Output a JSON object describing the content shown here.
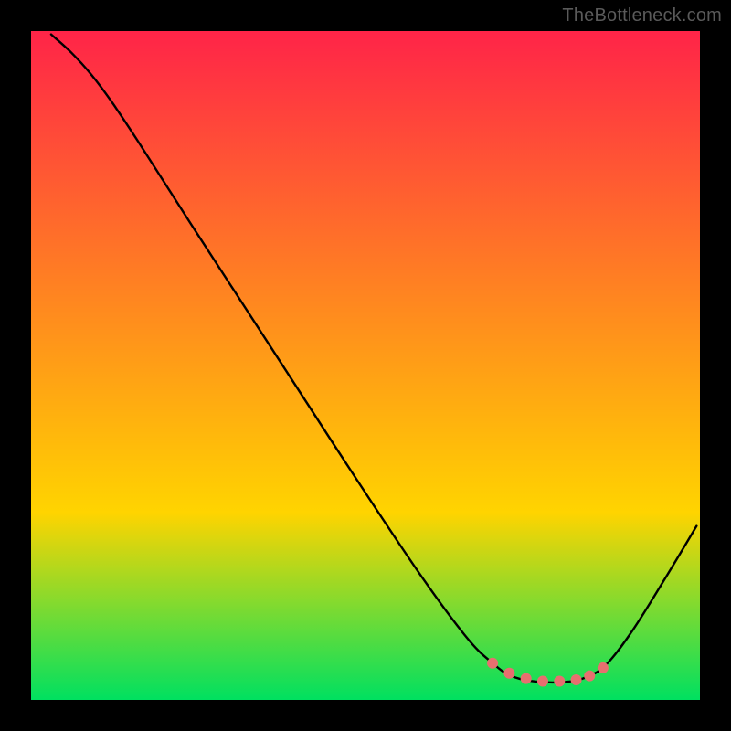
{
  "watermark": "TheBottleneck.com",
  "gradient": {
    "top": "#ff2448",
    "mid": "#ffd400",
    "bottom": "#00e060"
  },
  "curve_color": "#000000",
  "marker_color": "#e76f6f",
  "chart_data": {
    "type": "line",
    "title": "",
    "xlabel": "",
    "ylabel": "",
    "xlim": [
      0,
      100
    ],
    "ylim": [
      0,
      100
    ],
    "series": [
      {
        "name": "curve",
        "points": [
          {
            "x": 3.0,
            "y": 99.5
          },
          {
            "x": 6.0,
            "y": 96.8
          },
          {
            "x": 9.0,
            "y": 93.5
          },
          {
            "x": 12.0,
            "y": 89.5
          },
          {
            "x": 16.0,
            "y": 83.5
          },
          {
            "x": 24.0,
            "y": 71.0
          },
          {
            "x": 36.0,
            "y": 52.5
          },
          {
            "x": 48.0,
            "y": 34.0
          },
          {
            "x": 58.0,
            "y": 19.0
          },
          {
            "x": 65.0,
            "y": 9.5
          },
          {
            "x": 69.0,
            "y": 5.5
          },
          {
            "x": 72.0,
            "y": 3.5
          },
          {
            "x": 76.0,
            "y": 2.7
          },
          {
            "x": 80.0,
            "y": 2.7
          },
          {
            "x": 83.0,
            "y": 3.4
          },
          {
            "x": 86.0,
            "y": 5.3
          },
          {
            "x": 90.0,
            "y": 10.5
          },
          {
            "x": 95.0,
            "y": 18.5
          },
          {
            "x": 99.5,
            "y": 26.0
          }
        ]
      }
    ],
    "markers": {
      "name": "bottom-cluster",
      "points": [
        {
          "x": 69.0,
          "y": 5.5
        },
        {
          "x": 71.5,
          "y": 4.0
        },
        {
          "x": 74.0,
          "y": 3.2
        },
        {
          "x": 76.5,
          "y": 2.8
        },
        {
          "x": 79.0,
          "y": 2.8
        },
        {
          "x": 81.5,
          "y": 3.0
        },
        {
          "x": 83.5,
          "y": 3.6
        },
        {
          "x": 85.5,
          "y": 4.8
        }
      ],
      "radius_px": 6
    }
  }
}
